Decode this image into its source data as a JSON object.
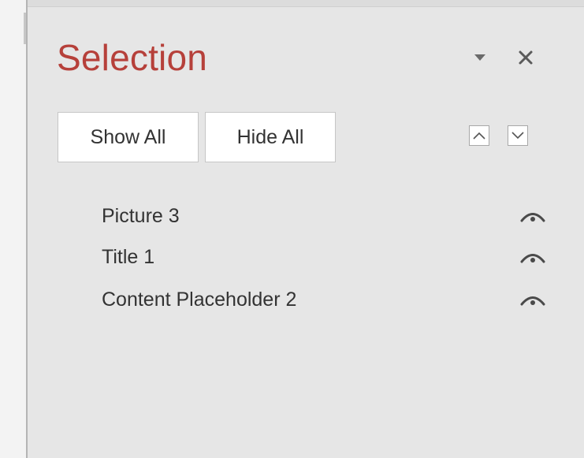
{
  "pane": {
    "title": "Selection",
    "title_color": "#b6403a",
    "options_icon": "triangle-down-icon",
    "close_icon": "close-icon"
  },
  "buttons": {
    "show_all": "Show All",
    "hide_all": "Hide All",
    "bring_forward_icon": "chevron-up-icon",
    "send_backward_icon": "chevron-down-icon"
  },
  "items": [
    {
      "label": "Picture 3",
      "visibility_icon": "eye-icon",
      "visible": true
    },
    {
      "label": "Title 1",
      "visibility_icon": "eye-icon",
      "visible": true
    },
    {
      "label": "Content Placeholder 2",
      "visibility_icon": "eye-icon",
      "visible": true
    }
  ]
}
